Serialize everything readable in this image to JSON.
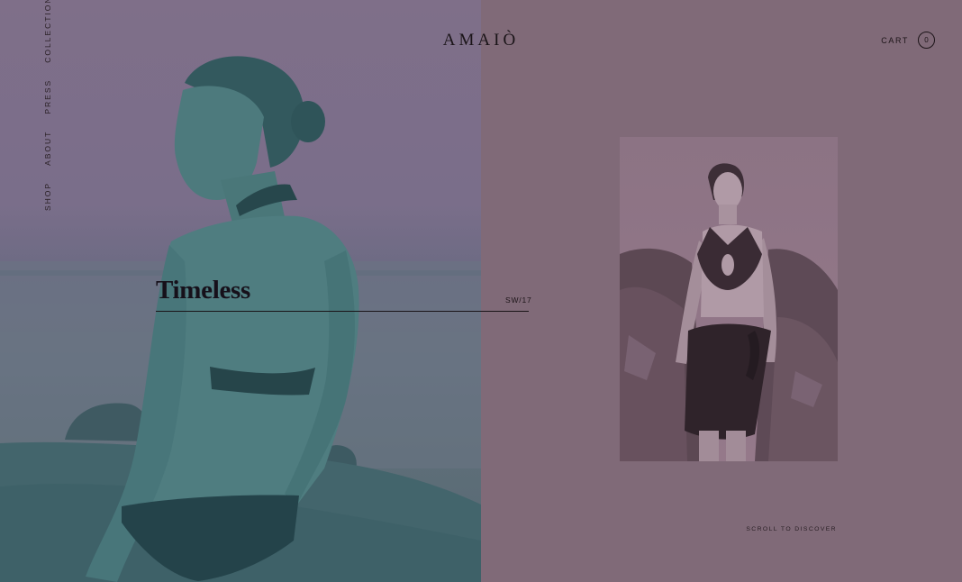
{
  "brand": {
    "logo": "AMAIÒ"
  },
  "nav": {
    "items": [
      {
        "label": "SHOP"
      },
      {
        "label": "ABOUT"
      },
      {
        "label": "PRESS"
      },
      {
        "label": "COLLECTION"
      }
    ]
  },
  "cart": {
    "label": "CART",
    "count": "0"
  },
  "hero": {
    "headline": "Timeless",
    "season_code": "SW/17"
  },
  "footer": {
    "scroll_hint": "SCROLL TO DISCOVER"
  },
  "colors": {
    "overlay_mauve": "#806a78",
    "hero_teal": "#3f6e72",
    "text_dark": "#1c1418"
  }
}
